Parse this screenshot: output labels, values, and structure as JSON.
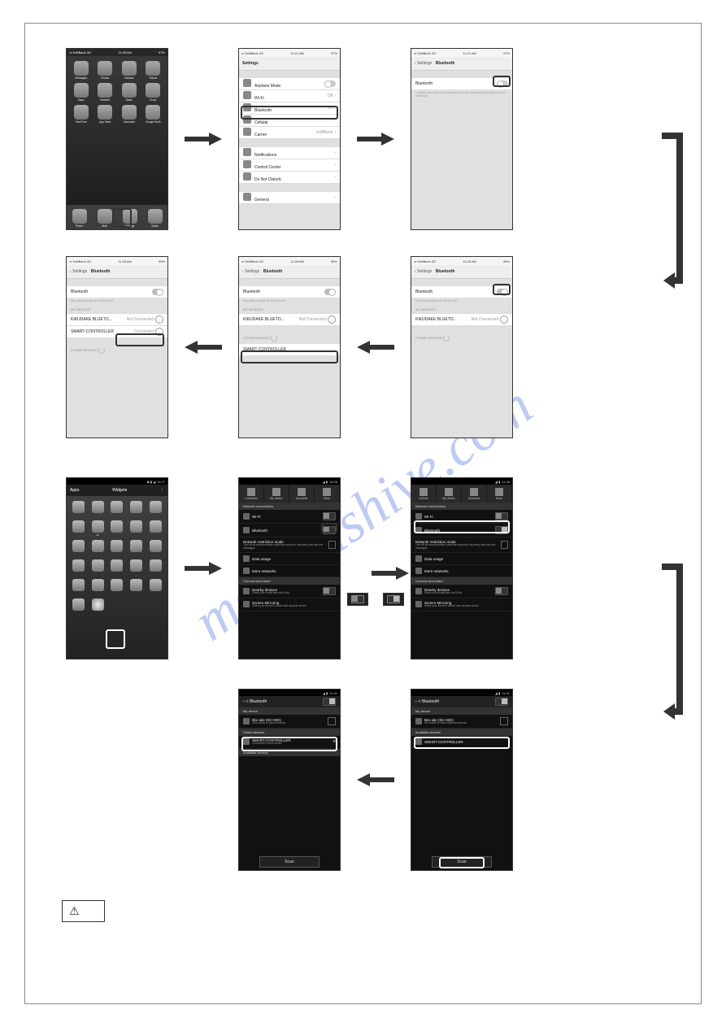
{
  "watermark": "manualshive.com",
  "ios": {
    "status_carrier": "•ıl SoftBank  3G",
    "status_time1": "11:25 AM",
    "status_time2": "11:21 AM",
    "status_time3": "11:28 AM",
    "status_batt": "97%",
    "status_batt2": "96%",
    "status_batt3": "95%",
    "home_icons": [
      "Messages",
      "Photos",
      "Camera",
      "Videos",
      "Maps",
      "Weather",
      "Notes",
      "Clock",
      "FaceTime",
      "App Store",
      "Calendars",
      "Google Earth"
    ],
    "dock_icons": [
      "Phone",
      "Mail",
      "Settings",
      "Music"
    ]
  },
  "settings": {
    "title": "Settings",
    "airplane": "Airplane Mode",
    "wifi": "Wi-Fi",
    "wifi_status": "Off",
    "bluetooth": "Bluetooth",
    "bluetooth_status": "Off",
    "cellular": "Cellular",
    "carrier": "Carrier",
    "carrier_name": "SoftBank",
    "notifications": "Notifications",
    "control_center": "Control Center",
    "dnd": "Do Not Disturb",
    "general": "General"
  },
  "bt": {
    "back": "Settings",
    "title": "Bluetooth",
    "label": "Bluetooth",
    "off_desc": "Location accuracy and nearby services are improved when Bluetooth is turned on.",
    "discoverable": "Now discoverable as \"Hiromi Itoh\".",
    "my_devices": "MY DEVICES",
    "other_devices": "OTHER DEVICES",
    "dev1": "KIKUDAKE BLUETO...",
    "dev1_status": "Not Connected",
    "dev2": "SMART-CONTROLLER",
    "dev2_status_conn": "Connected"
  },
  "android": {
    "status_time": "14:05",
    "status_time2": "11:28",
    "status_time3": "11:31",
    "launcher_apps": "Apps",
    "launcher_widgets": "Widgets",
    "launch_time": "11:27",
    "tabs": [
      "Connectio",
      "My device",
      "Accounts",
      "More"
    ],
    "tabs2": [
      "ections",
      "My device",
      "Accounts",
      "More"
    ],
    "section_network": "Network connections",
    "wifi": "Wi-Fi",
    "bluetooth": "Bluetooth",
    "restriction": "Network restriction mode",
    "restriction_sub": "Turn off all communication methods except for incoming calls and text messages",
    "data_usage": "Data usage",
    "more_networks": "More networks",
    "section_share": "Connect and share",
    "nearby": "Nearby devices",
    "nearby_sub": "Share your media files via DLNA",
    "mirroring": "Screen Mirroring",
    "mirroring_sub": "Share your device's screen with another device"
  },
  "abt": {
    "title": "Bluetooth",
    "my_device": "My device",
    "device_name": "5ko    uke (SC-02E)",
    "device_sub_hidden": "Not visible to other bluetooth devices",
    "device_sub_visible": "Only visible to paired devices",
    "available": "Available devices",
    "paired": "Paired devices",
    "smart": "SMART-CONTROLLER",
    "smart_sub": "Connected to input device",
    "scan": "Scan"
  }
}
